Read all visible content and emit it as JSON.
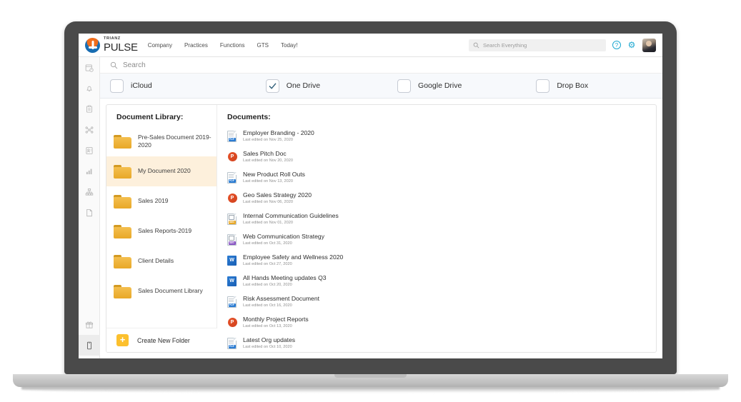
{
  "header": {
    "logo_small": "TRIANZ",
    "logo_main": "PULSE",
    "nav": [
      {
        "label": "Company"
      },
      {
        "label": "Practices"
      },
      {
        "label": "Functions"
      },
      {
        "label": "GTS"
      },
      {
        "label": "Today!"
      }
    ],
    "search_placeholder": "Search Everything",
    "help_icon": "question-mark",
    "settings_icon": "gear",
    "avatar_icon": "user-avatar"
  },
  "left_rail": {
    "items": [
      {
        "icon": "calendar-clock-icon",
        "selected": false
      },
      {
        "icon": "bell-icon",
        "selected": false
      },
      {
        "icon": "clipboard-icon",
        "selected": false
      },
      {
        "icon": "share-network-icon",
        "selected": false
      },
      {
        "icon": "contact-card-icon",
        "selected": false
      },
      {
        "icon": "bar-chart-icon",
        "selected": false
      },
      {
        "icon": "org-chart-icon",
        "selected": false
      },
      {
        "icon": "document-icon",
        "selected": false
      }
    ],
    "bottom_items": [
      {
        "icon": "gift-icon",
        "selected": false
      },
      {
        "icon": "mobile-phone-icon",
        "selected": true
      }
    ]
  },
  "search_bar": {
    "placeholder": "Search",
    "icon": "search-icon"
  },
  "sources": [
    {
      "label": "iCloud",
      "checked": false
    },
    {
      "label": "One Drive",
      "checked": true
    },
    {
      "label": "Google Drive",
      "checked": false
    },
    {
      "label": "Drop Box",
      "checked": false
    }
  ],
  "library": {
    "title": "Document Library:",
    "folders": [
      {
        "label": "Pre-Sales Document 2019-2020",
        "selected": false
      },
      {
        "label": "My Document 2020",
        "selected": true
      },
      {
        "label": "Sales 2019",
        "selected": false
      },
      {
        "label": "Sales Reports-2019",
        "selected": false
      },
      {
        "label": "Client Details",
        "selected": false
      },
      {
        "label": "Sales Document Library",
        "selected": false
      }
    ],
    "create_folder_label": "Create New Folder",
    "create_folder_icon": "plus-icon"
  },
  "documents": {
    "title": "Documents:",
    "items": [
      {
        "name": "Employer Branding - 2020",
        "sub": "Last edited on Nov 25, 2020",
        "type": "pdf"
      },
      {
        "name": "Sales Pitch Doc",
        "sub": "Last edited on Nov 20, 2020",
        "type": "ppt"
      },
      {
        "name": "New Product Roll Outs",
        "sub": "Last edited on Nov 13, 2020",
        "type": "pdf"
      },
      {
        "name": "Geo Sales Strategy 2020",
        "sub": "Last edited on Nov 06, 2020",
        "type": "ppt"
      },
      {
        "name": "Internal Communication Guidelines",
        "sub": "Last edited on Nov 01, 2020",
        "type": "image-orange"
      },
      {
        "name": "Web Communication Strategy",
        "sub": "Last edited on Oct 31, 2020",
        "type": "image-purple"
      },
      {
        "name": "Employee Safety and Wellness 2020",
        "sub": "Last edited on Oct 27, 2020",
        "type": "word"
      },
      {
        "name": "All Hands Meeting updates Q3",
        "sub": "Last edited on Oct 20, 2020",
        "type": "word"
      },
      {
        "name": "Risk Assessment Document",
        "sub": "Last edited on Oct 16, 2020",
        "type": "pdf"
      },
      {
        "name": "Monthly Project Reports",
        "sub": "Last edited on Oct 13, 2020",
        "type": "ppt"
      },
      {
        "name": "Latest Org updates",
        "sub": "Last edited on Oct 10, 2020",
        "type": "pdf"
      }
    ]
  },
  "colors": {
    "accent_blue": "#1ca7d0",
    "folder_yellow": "#e8a828",
    "selected_row": "#fdf0dc",
    "plus_button": "#fcc02e",
    "checkbox_check": "#2f5d78",
    "bezel": "#4a4a4a"
  }
}
